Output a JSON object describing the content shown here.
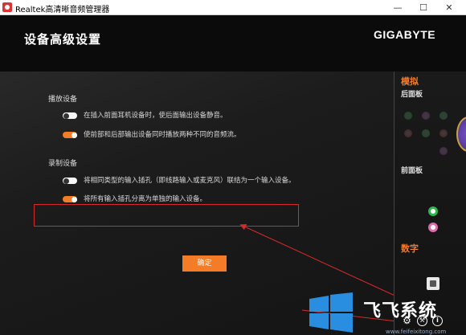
{
  "window": {
    "title": "Realtek高清晰音频管理器",
    "min_glyph": "—",
    "max_glyph": "☐",
    "close_glyph": "✕"
  },
  "header": {
    "title": "设备高级设置",
    "brand": "GIGABYTE"
  },
  "playback": {
    "title": "播放设备",
    "options": [
      {
        "label": "在插入前面耳机设备时，使后面输出设备静音。",
        "on": false
      },
      {
        "label": "使前部和后部输出设备同时播放两种不同的音频流。",
        "on": true
      }
    ]
  },
  "recording": {
    "title": "录制设备",
    "options": [
      {
        "label": "将相同类型的输入插孔（即线路输入或麦克风）联结为一个输入设备。",
        "on": false
      },
      {
        "label": "将所有输入插孔分离为单独的输入设备。",
        "on": true
      }
    ]
  },
  "confirm_label": "确定",
  "right_panel": {
    "analog_title": "模拟",
    "rear_panel": "后面板",
    "front_panel": "前面板",
    "digital_title": "数字"
  },
  "bottom_icons": {
    "settings": "gear-icon",
    "wrench": "wrench-icon",
    "info": "i"
  },
  "watermark": {
    "text": "飞飞系统",
    "url": "www.feifeixitong.com"
  },
  "colors": {
    "accent": "#f57c26",
    "highlight_border": "#d42a2a",
    "jack_green": "#2eb84a",
    "jack_pink": "#e06ab0"
  }
}
